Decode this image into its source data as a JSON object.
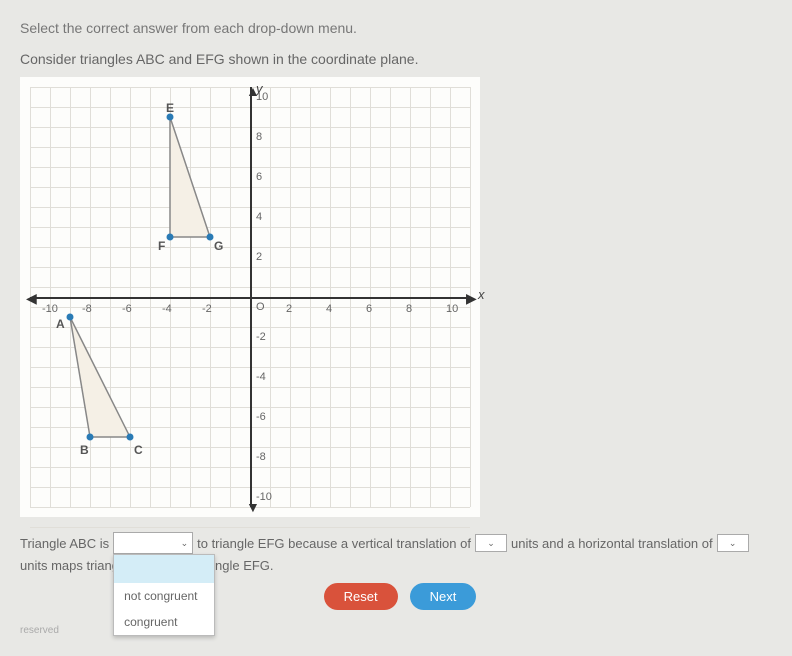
{
  "instruction": "Select the correct answer from each drop-down menu.",
  "subinstruction": "Consider triangles ABC and EFG shown in the coordinate plane.",
  "axis": {
    "y": "y",
    "x": "x",
    "origin": "O"
  },
  "ticks": {
    "xneg": [
      "-10",
      "-8",
      "-6",
      "-4",
      "-2"
    ],
    "xpos": [
      "2",
      "4",
      "6",
      "8",
      "10"
    ],
    "ypos": [
      "2",
      "4",
      "6",
      "8",
      "10"
    ],
    "yneg": [
      "-2",
      "-4",
      "-6",
      "-8",
      "-10"
    ]
  },
  "points": {
    "A": "A",
    "B": "B",
    "C": "C",
    "E": "E",
    "F": "F",
    "G": "G"
  },
  "sentence": {
    "p1": "Triangle ABC is",
    "p2": "to triangle EFG because a vertical translation of",
    "p3": "units and a horizontal translation of",
    "p4": "units maps triang",
    "p5": "ngle EFG."
  },
  "dropdown": {
    "opt1": "not congruent",
    "opt2": "congruent"
  },
  "buttons": {
    "reset": "Reset",
    "next": "Next"
  },
  "footer": "reserved",
  "chart_data": {
    "type": "scatter",
    "title": "",
    "xlabel": "x",
    "ylabel": "y",
    "xlim": [
      -11,
      11
    ],
    "ylim": [
      -11,
      11
    ],
    "series": [
      {
        "name": "Triangle ABC",
        "points": [
          {
            "x": -9,
            "y": -1,
            "label": "A"
          },
          {
            "x": -8,
            "y": -7,
            "label": "B"
          },
          {
            "x": -6,
            "y": -7,
            "label": "C"
          }
        ]
      },
      {
        "name": "Triangle EFG",
        "points": [
          {
            "x": -4,
            "y": 9,
            "label": "E"
          },
          {
            "x": -4,
            "y": 3,
            "label": "F"
          },
          {
            "x": -2,
            "y": 3,
            "label": "G"
          }
        ]
      }
    ]
  }
}
